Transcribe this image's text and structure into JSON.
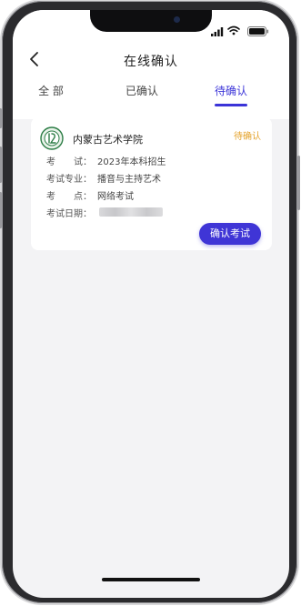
{
  "header": {
    "title": "在线确认",
    "back_icon": "chevron-left-icon"
  },
  "tabs": [
    {
      "label": "全 部",
      "active": false
    },
    {
      "label": "已确认",
      "active": false
    },
    {
      "label": "待确认",
      "active": true
    }
  ],
  "colors": {
    "accent": "#3b34d8",
    "pending": "#e4a32c",
    "background": "#f3f3f5"
  },
  "card": {
    "school_logo": "school-emblem-icon",
    "school_name": "内蒙古艺术学院",
    "status": "待确认",
    "rows": [
      {
        "label": "考　　试：",
        "value": "2023年本科招生"
      },
      {
        "label": "考试专业：",
        "value": "播音与主持艺术"
      },
      {
        "label": "考　　点：",
        "value": "网络考试"
      },
      {
        "label": "考试日期：",
        "value": ""
      }
    ],
    "button_label": "确认考试"
  }
}
